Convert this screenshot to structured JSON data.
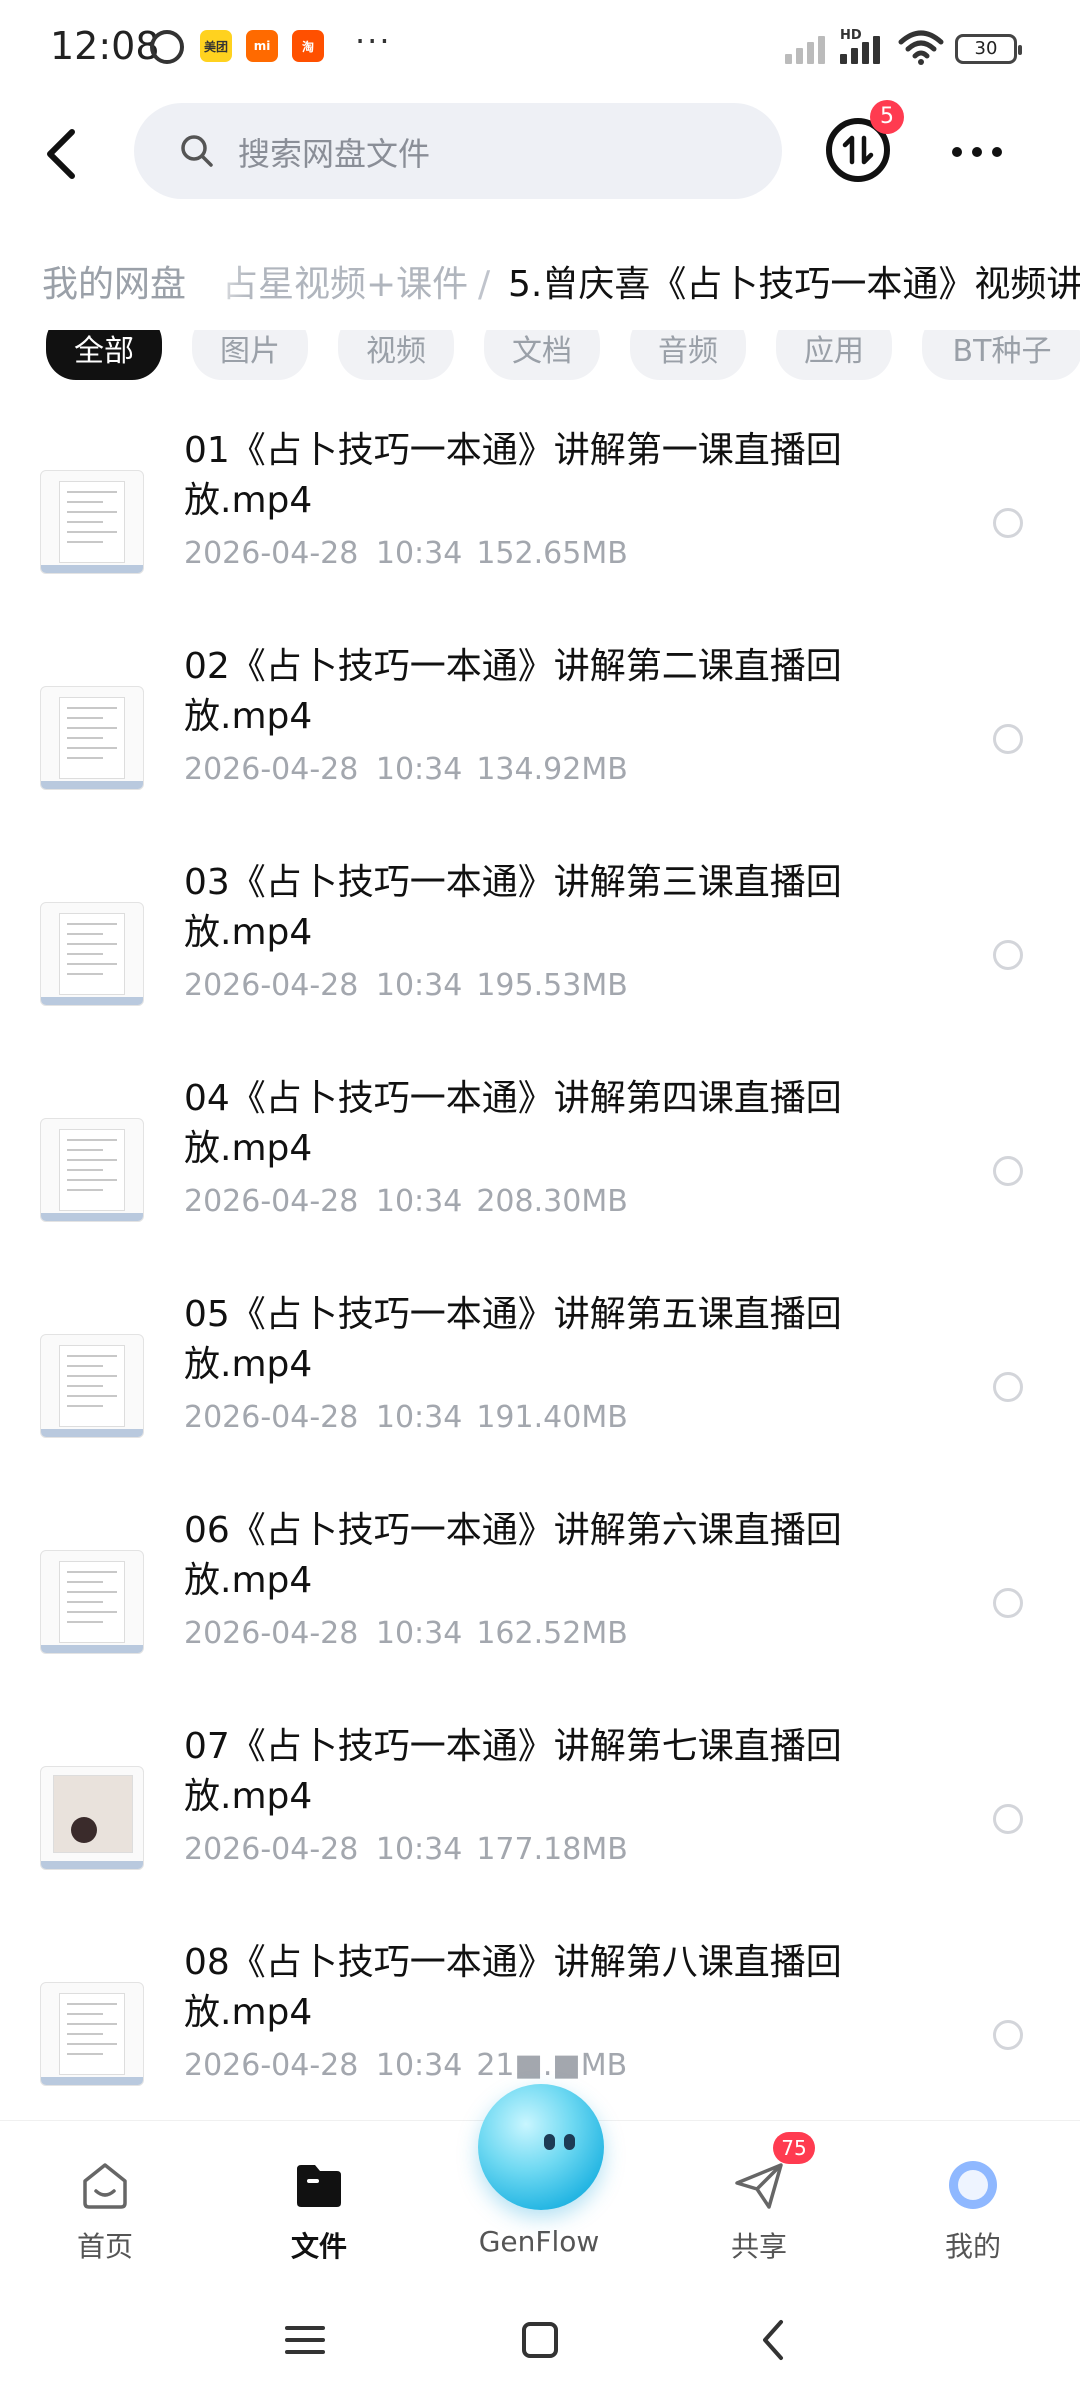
{
  "status_bar": {
    "time": "12:08",
    "apps": [
      "美团",
      "mi",
      "淘"
    ],
    "more": "···",
    "network": "HD",
    "battery": "30"
  },
  "header": {
    "search_placeholder": "搜索网盘文件",
    "transfer_badge": "5"
  },
  "breadcrumb": {
    "root": "我的网盘",
    "parent": "占星视频+课件",
    "separator": "/",
    "current": "5.曾庆喜《占卜技巧一本通》视频讲"
  },
  "filters": [
    "全部",
    "图片",
    "视频",
    "文档",
    "音频",
    "应用",
    "BT种子"
  ],
  "files": [
    {
      "name": "01《占卜技巧一本通》讲解第一课直播回放.mp4",
      "date": "2026-04-28  10:34",
      "size": "152.65MB",
      "thumb": "doc"
    },
    {
      "name": "02《占卜技巧一本通》讲解第二课直播回放.mp4",
      "date": "2026-04-28  10:34",
      "size": "134.92MB",
      "thumb": "doc"
    },
    {
      "name": "03《占卜技巧一本通》讲解第三课直播回放.mp4",
      "date": "2026-04-28  10:34",
      "size": "195.53MB",
      "thumb": "doc"
    },
    {
      "name": "04《占卜技巧一本通》讲解第四课直播回放.mp4",
      "date": "2026-04-28  10:34",
      "size": "208.30MB",
      "thumb": "doc"
    },
    {
      "name": "05《占卜技巧一本通》讲解第五课直播回放.mp4",
      "date": "2026-04-28  10:34",
      "size": "191.40MB",
      "thumb": "doc"
    },
    {
      "name": "06《占卜技巧一本通》讲解第六课直播回放.mp4",
      "date": "2026-04-28  10:34",
      "size": "162.52MB",
      "thumb": "doc"
    },
    {
      "name": "07《占卜技巧一本通》讲解第七课直播回放.mp4",
      "date": "2026-04-28  10:34",
      "size": "177.18MB",
      "thumb": "photo"
    },
    {
      "name": "08《占卜技巧一本通》讲解第八课直播回放.mp4",
      "date": "2026-04-28  10:34",
      "size": "21■.■MB",
      "thumb": "doc"
    }
  ],
  "bottom_nav": {
    "home": "首页",
    "files": "文件",
    "genflow": "GenFlow",
    "share": "共享",
    "share_badge": "75",
    "me": "我的"
  },
  "colors": {
    "accent_black": "#111111",
    "badge_red": "#ff3b50",
    "search_bg": "#eef0f5",
    "meta_gray": "#a3a7ae",
    "genflow_blue": "#25b6e3"
  }
}
